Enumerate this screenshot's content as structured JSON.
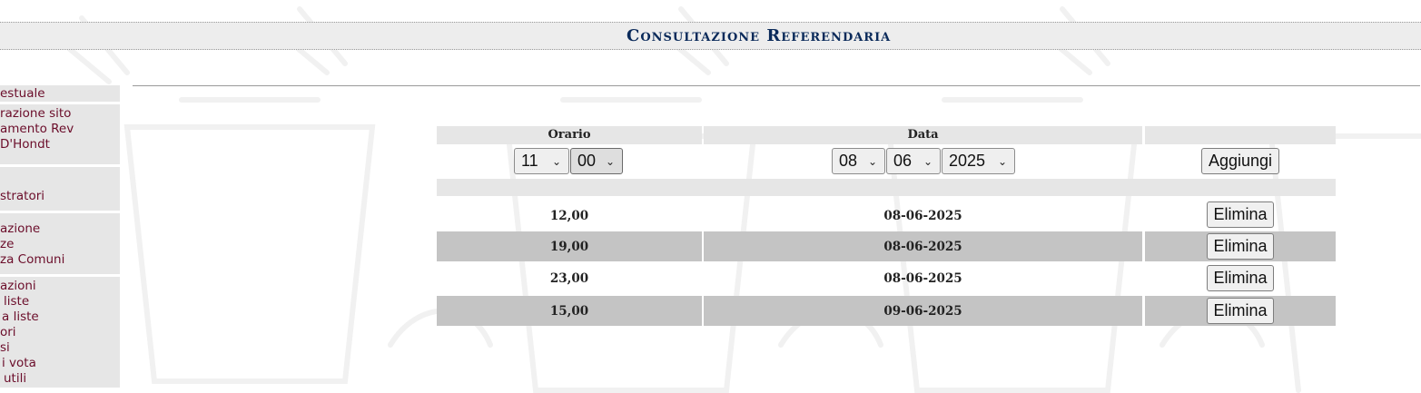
{
  "page": {
    "title": "Consultazione Referendaria"
  },
  "sidebar": {
    "items": [
      "estuale",
      "razione sito",
      "amento Rev",
      "D'Hondt",
      "stratori",
      "azione",
      "ze",
      "za Comuni",
      "azioni",
      "liste",
      "a liste",
      "ori",
      "si",
      "i vota",
      "utili"
    ]
  },
  "form": {
    "headers": {
      "orario": "Orario",
      "data": "Data"
    },
    "hour": "11",
    "minute": "00",
    "day": "08",
    "month": "06",
    "year": "2025",
    "add_label": "Aggiungi"
  },
  "rows": [
    {
      "time": "12,00",
      "date": "08-06-2025",
      "action": "Elimina"
    },
    {
      "time": "19,00",
      "date": "08-06-2025",
      "action": "Elimina"
    },
    {
      "time": "23,00",
      "date": "08-06-2025",
      "action": "Elimina"
    },
    {
      "time": "15,00",
      "date": "09-06-2025",
      "action": "Elimina"
    }
  ],
  "icons": {
    "dropdown": "chevron-down-icon",
    "background": "ballot-box-watermark"
  },
  "colors": {
    "title": "#0a2a5a",
    "sidebar_link": "#6b0d2a",
    "band": "#e6e6e6",
    "row_shade": "#c4c4c4"
  }
}
